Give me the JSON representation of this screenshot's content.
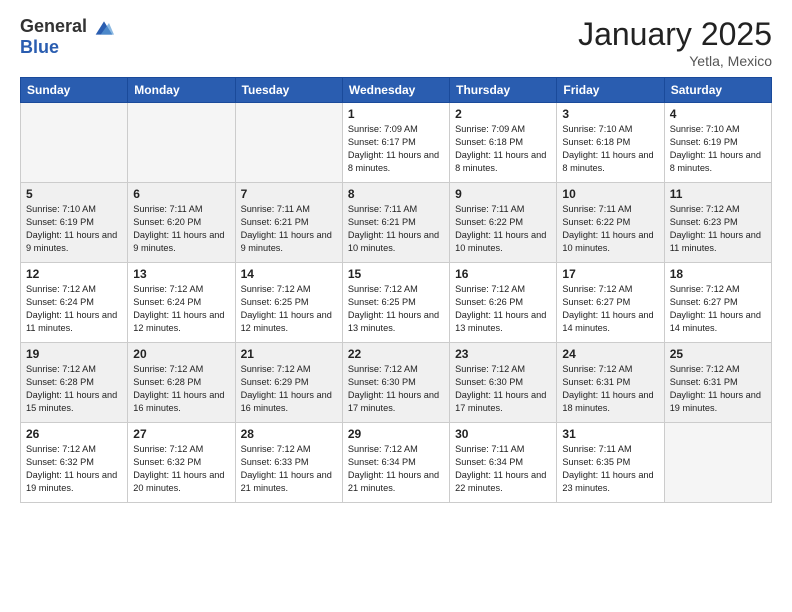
{
  "header": {
    "logo": {
      "general": "General",
      "blue": "Blue"
    },
    "title": "January 2025",
    "location": "Yetla, Mexico"
  },
  "weekdays": [
    "Sunday",
    "Monday",
    "Tuesday",
    "Wednesday",
    "Thursday",
    "Friday",
    "Saturday"
  ],
  "weeks": [
    [
      {
        "day": "",
        "empty": true
      },
      {
        "day": "",
        "empty": true
      },
      {
        "day": "",
        "empty": true
      },
      {
        "day": "1",
        "sunrise": "7:09 AM",
        "sunset": "6:17 PM",
        "daylight": "11 hours and 8 minutes."
      },
      {
        "day": "2",
        "sunrise": "7:09 AM",
        "sunset": "6:18 PM",
        "daylight": "11 hours and 8 minutes."
      },
      {
        "day": "3",
        "sunrise": "7:10 AM",
        "sunset": "6:18 PM",
        "daylight": "11 hours and 8 minutes."
      },
      {
        "day": "4",
        "sunrise": "7:10 AM",
        "sunset": "6:19 PM",
        "daylight": "11 hours and 8 minutes."
      }
    ],
    [
      {
        "day": "5",
        "sunrise": "7:10 AM",
        "sunset": "6:19 PM",
        "daylight": "11 hours and 9 minutes."
      },
      {
        "day": "6",
        "sunrise": "7:11 AM",
        "sunset": "6:20 PM",
        "daylight": "11 hours and 9 minutes."
      },
      {
        "day": "7",
        "sunrise": "7:11 AM",
        "sunset": "6:21 PM",
        "daylight": "11 hours and 9 minutes."
      },
      {
        "day": "8",
        "sunrise": "7:11 AM",
        "sunset": "6:21 PM",
        "daylight": "11 hours and 10 minutes."
      },
      {
        "day": "9",
        "sunrise": "7:11 AM",
        "sunset": "6:22 PM",
        "daylight": "11 hours and 10 minutes."
      },
      {
        "day": "10",
        "sunrise": "7:11 AM",
        "sunset": "6:22 PM",
        "daylight": "11 hours and 10 minutes."
      },
      {
        "day": "11",
        "sunrise": "7:12 AM",
        "sunset": "6:23 PM",
        "daylight": "11 hours and 11 minutes."
      }
    ],
    [
      {
        "day": "12",
        "sunrise": "7:12 AM",
        "sunset": "6:24 PM",
        "daylight": "11 hours and 11 minutes."
      },
      {
        "day": "13",
        "sunrise": "7:12 AM",
        "sunset": "6:24 PM",
        "daylight": "11 hours and 12 minutes."
      },
      {
        "day": "14",
        "sunrise": "7:12 AM",
        "sunset": "6:25 PM",
        "daylight": "11 hours and 12 minutes."
      },
      {
        "day": "15",
        "sunrise": "7:12 AM",
        "sunset": "6:25 PM",
        "daylight": "11 hours and 13 minutes."
      },
      {
        "day": "16",
        "sunrise": "7:12 AM",
        "sunset": "6:26 PM",
        "daylight": "11 hours and 13 minutes."
      },
      {
        "day": "17",
        "sunrise": "7:12 AM",
        "sunset": "6:27 PM",
        "daylight": "11 hours and 14 minutes."
      },
      {
        "day": "18",
        "sunrise": "7:12 AM",
        "sunset": "6:27 PM",
        "daylight": "11 hours and 14 minutes."
      }
    ],
    [
      {
        "day": "19",
        "sunrise": "7:12 AM",
        "sunset": "6:28 PM",
        "daylight": "11 hours and 15 minutes."
      },
      {
        "day": "20",
        "sunrise": "7:12 AM",
        "sunset": "6:28 PM",
        "daylight": "11 hours and 16 minutes."
      },
      {
        "day": "21",
        "sunrise": "7:12 AM",
        "sunset": "6:29 PM",
        "daylight": "11 hours and 16 minutes."
      },
      {
        "day": "22",
        "sunrise": "7:12 AM",
        "sunset": "6:30 PM",
        "daylight": "11 hours and 17 minutes."
      },
      {
        "day": "23",
        "sunrise": "7:12 AM",
        "sunset": "6:30 PM",
        "daylight": "11 hours and 17 minutes."
      },
      {
        "day": "24",
        "sunrise": "7:12 AM",
        "sunset": "6:31 PM",
        "daylight": "11 hours and 18 minutes."
      },
      {
        "day": "25",
        "sunrise": "7:12 AM",
        "sunset": "6:31 PM",
        "daylight": "11 hours and 19 minutes."
      }
    ],
    [
      {
        "day": "26",
        "sunrise": "7:12 AM",
        "sunset": "6:32 PM",
        "daylight": "11 hours and 19 minutes."
      },
      {
        "day": "27",
        "sunrise": "7:12 AM",
        "sunset": "6:32 PM",
        "daylight": "11 hours and 20 minutes."
      },
      {
        "day": "28",
        "sunrise": "7:12 AM",
        "sunset": "6:33 PM",
        "daylight": "11 hours and 21 minutes."
      },
      {
        "day": "29",
        "sunrise": "7:12 AM",
        "sunset": "6:34 PM",
        "daylight": "11 hours and 21 minutes."
      },
      {
        "day": "30",
        "sunrise": "7:11 AM",
        "sunset": "6:34 PM",
        "daylight": "11 hours and 22 minutes."
      },
      {
        "day": "31",
        "sunrise": "7:11 AM",
        "sunset": "6:35 PM",
        "daylight": "11 hours and 23 minutes."
      },
      {
        "day": "",
        "empty": true
      }
    ]
  ]
}
